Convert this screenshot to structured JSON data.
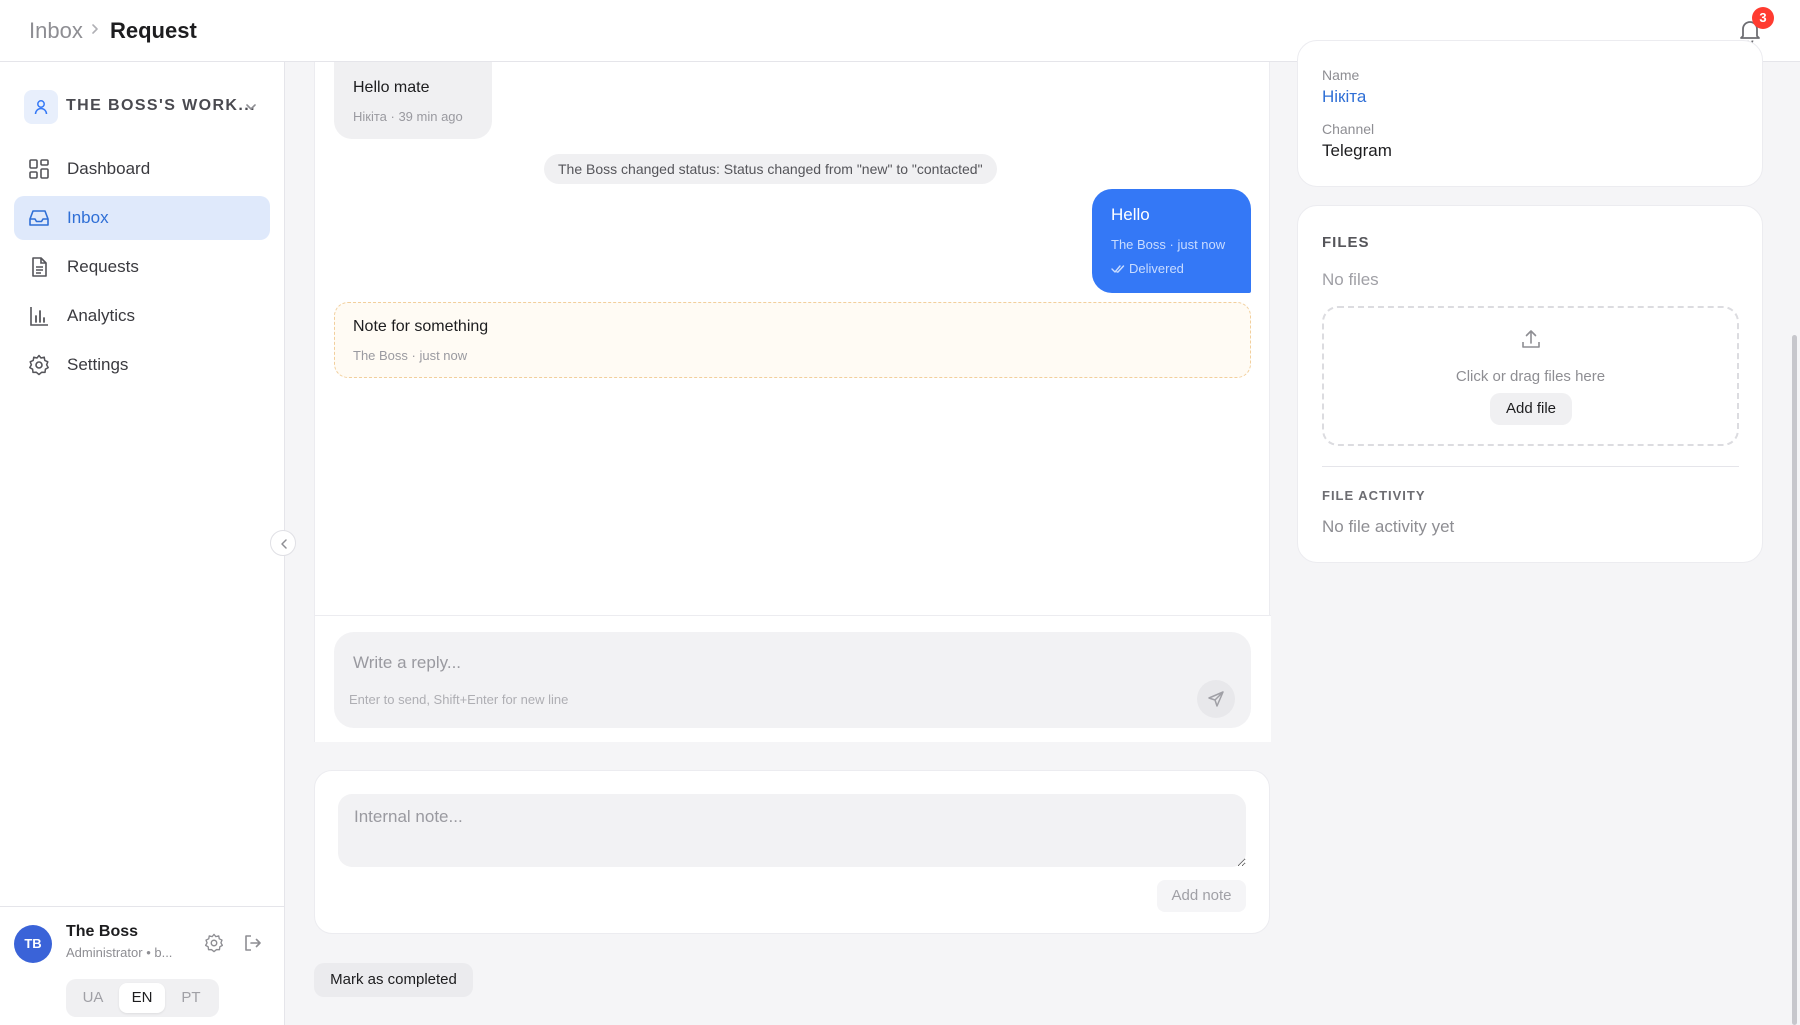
{
  "header": {
    "breadcrumb_root": "Inbox",
    "breadcrumb_current": "Request",
    "notifications_count": "3"
  },
  "sidebar": {
    "workspace_name": "THE BOSS'S WORK...",
    "items": [
      {
        "label": "Dashboard",
        "icon": "dashboard-icon"
      },
      {
        "label": "Inbox",
        "icon": "inbox-icon",
        "active": true
      },
      {
        "label": "Requests",
        "icon": "document-icon"
      },
      {
        "label": "Analytics",
        "icon": "bar-chart-icon"
      },
      {
        "label": "Settings",
        "icon": "gear-icon"
      }
    ],
    "user": {
      "initials": "TB",
      "name": "The Boss",
      "role": "Administrator • b..."
    },
    "languages": [
      "UA",
      "EN",
      "PT"
    ],
    "active_language": "EN"
  },
  "conversation": {
    "messages": [
      {
        "type": "incoming",
        "text": "Hello mate",
        "meta": "Нікіта · 39 min ago"
      },
      {
        "type": "system",
        "text": "The Boss changed status: Status changed from \"new\" to \"contacted\""
      },
      {
        "type": "outgoing",
        "text": "Hello",
        "meta": "The Boss · just now",
        "status": "Delivered"
      },
      {
        "type": "note",
        "text": "Note for something",
        "meta": "The Boss · just now"
      }
    ],
    "reply": {
      "placeholder": "Write a reply...",
      "value": "",
      "hint": "Enter to send, Shift+Enter for new line"
    }
  },
  "internal_note": {
    "placeholder": "Internal note...",
    "value": "",
    "button": "Add note"
  },
  "actions": {
    "mark_completed": "Mark as completed"
  },
  "contact": {
    "name_label": "Name",
    "name_value": "Нікіта",
    "channel_label": "Channel",
    "channel_value": "Telegram"
  },
  "files": {
    "title": "FILES",
    "empty": "No files",
    "dropzone_text": "Click or drag files here",
    "add_button": "Add file",
    "activity_title": "FILE ACTIVITY",
    "activity_empty": "No file activity yet"
  },
  "colors": {
    "accent": "#3478f6",
    "nav_active_bg": "#dfe9fb",
    "badge": "#ff3b30",
    "note_border": "#f2cf9c"
  }
}
